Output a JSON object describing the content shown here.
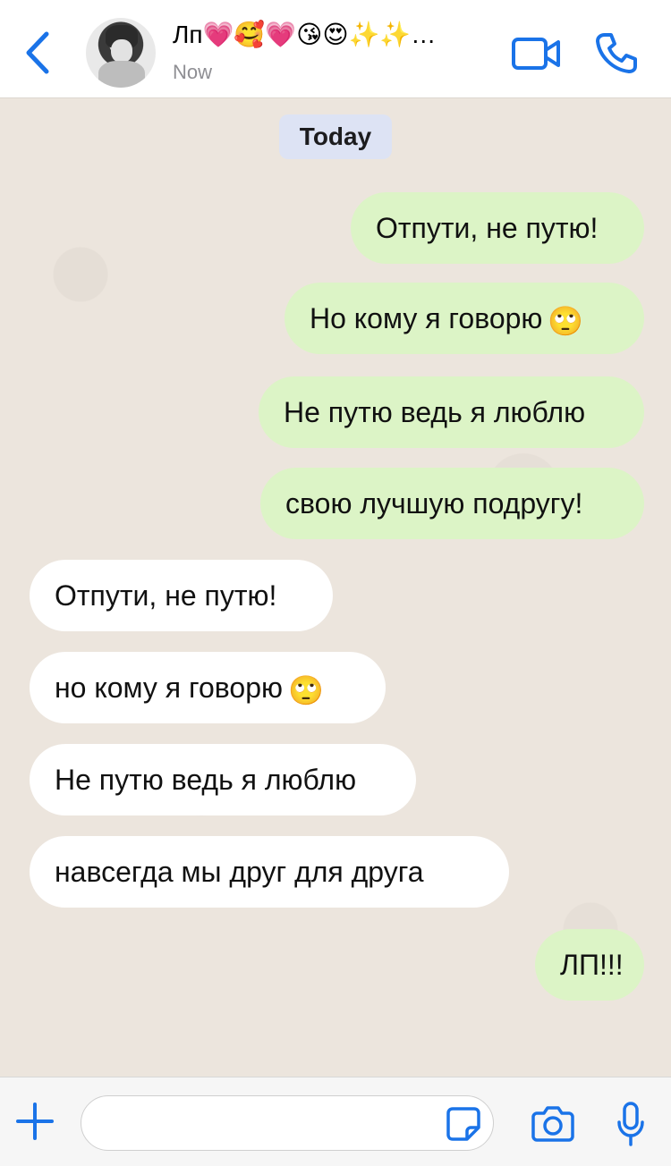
{
  "header": {
    "contact_name": "Лп💗🥰💗😘😍✨✨…",
    "status": "Now"
  },
  "chat": {
    "date_chip": "Today",
    "messages": [
      {
        "direction": "outgoing",
        "text": "Отпути, не путю!",
        "emoji": ""
      },
      {
        "direction": "outgoing",
        "text": "Но кому я говорю",
        "emoji": "🙄"
      },
      {
        "direction": "outgoing",
        "text": "Не путю ведь я люблю",
        "emoji": ""
      },
      {
        "direction": "outgoing",
        "text": "свою лучшую подругу!",
        "emoji": ""
      },
      {
        "direction": "incoming",
        "text": "Отпути, не путю!",
        "emoji": ""
      },
      {
        "direction": "incoming",
        "text": "но кому я говорю",
        "emoji": "🙄"
      },
      {
        "direction": "incoming",
        "text": "Не путю ведь я люблю",
        "emoji": ""
      },
      {
        "direction": "incoming",
        "text": "навсегда мы друг для друга",
        "emoji": ""
      },
      {
        "direction": "outgoing",
        "text": "ЛП!!!",
        "emoji": ""
      }
    ]
  },
  "input": {
    "placeholder": ""
  },
  "colors": {
    "accent": "#1a73e8",
    "outgoing_bubble": "#dcf4c6",
    "incoming_bubble": "#ffffff",
    "date_chip": "#dde3f4"
  },
  "icons": {
    "back": "chevron-left-icon",
    "video": "video-camera-icon",
    "call": "phone-icon",
    "plus": "plus-icon",
    "sticker": "sticker-icon",
    "camera": "camera-icon",
    "mic": "microphone-icon"
  }
}
